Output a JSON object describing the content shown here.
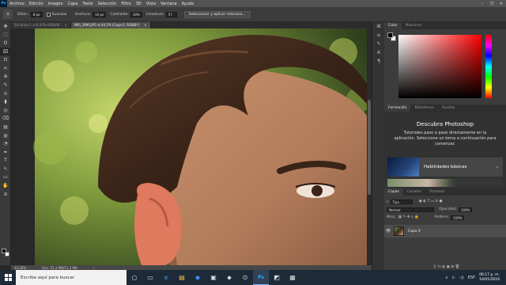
{
  "app": {
    "logo": "Ps",
    "menu": [
      "Archivo",
      "Edición",
      "Imagen",
      "Capa",
      "Texto",
      "Selección",
      "Filtro",
      "3D",
      "Vista",
      "Ventana",
      "Ayuda"
    ],
    "window_controls": [
      "–",
      "❐",
      "✕"
    ]
  },
  "options_bar": {
    "diameter_label": "Diám.:",
    "diameter_value": "8 px",
    "smooth_label": "Suavizar",
    "sample_label": "Anchura:",
    "sample_value": "10 px",
    "contrast_label": "Contraste:",
    "contrast_value": "10%",
    "frequency_label": "Lineatura:",
    "frequency_value": "57",
    "select_mask_button": "Seleccionar y aplicar máscara..."
  },
  "tools": [
    "✥",
    "⬚",
    "ʘ",
    "⌧",
    "⊡",
    "✍",
    "⊕",
    "✎",
    "⊙",
    "▮",
    "◎",
    "⌫",
    "▤",
    "◍",
    "◔",
    "✒",
    "T",
    "↖",
    "▭",
    "✋",
    "⊖",
    "…"
  ],
  "documents": {
    "tab1": "Sin título-1 al 8,33% (RGB/8)",
    "tab1_close": "×",
    "tab2": "IMG_3990.JPG al 44,3% (Capa 0, RGB/8*)",
    "tab2_close": "×"
  },
  "status": {
    "zoom": "44,28%",
    "doc": "Doc: 51,3 MB/51,3 MB",
    "arrow": "›"
  },
  "color_panel": {
    "tabs": [
      "Color",
      "Muestras"
    ]
  },
  "learn_panel": {
    "tabs": [
      "Formación",
      "Bibliotecas",
      "Ajustes"
    ],
    "title": "Descubra Photoshop",
    "description": "Tutoriales paso a paso directamente en la aplicación. Seleccione un tema a continuación para comenzar.",
    "card_label": "Habilidades básicas",
    "card_chevron": "›"
  },
  "layers_panel": {
    "tabs": [
      "Capas",
      "Canales",
      "Trazados"
    ],
    "filter_value": "Tipo",
    "blend_mode": "Normal",
    "opacity_label": "Opacidad:",
    "opacity_value": "100%",
    "lock_label": "Bloq.:",
    "fill_label": "Relleno:",
    "fill_value": "100%",
    "layer_name": "Capa 0",
    "bottom_icons": "ⓖ fx ◐ ▣ ⊞ 🗑"
  },
  "taskbar": {
    "search_placeholder": "Escribe aquí para buscar",
    "apps": [
      "○",
      "▭",
      "e",
      "▤",
      "◆",
      "▣",
      "⬥",
      "⊙",
      "Ps",
      "◩",
      "▦"
    ],
    "tray": [
      "∧",
      "⊏",
      "◁)",
      "ESP"
    ],
    "time": "06:17 p. m.",
    "date": "10/01/2019"
  }
}
